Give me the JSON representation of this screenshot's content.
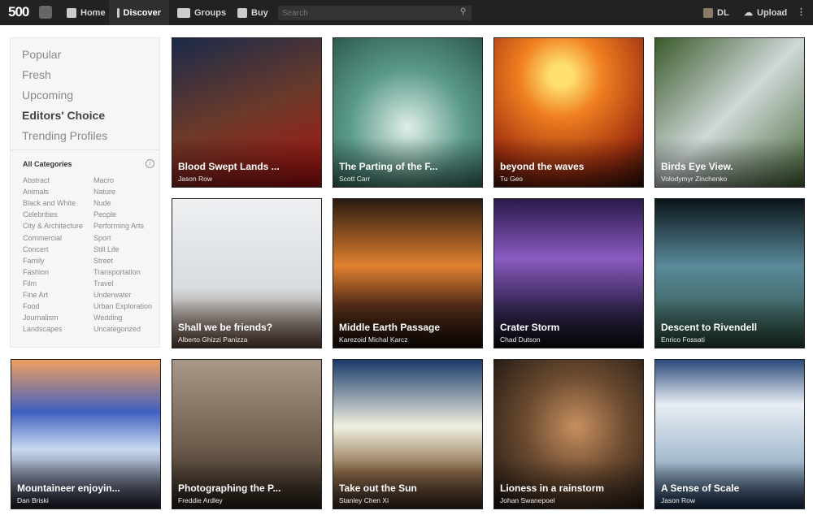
{
  "header": {
    "logo": "500",
    "nav": [
      "Home",
      "Discover",
      "Groups",
      "Buy"
    ],
    "search_placeholder": "Search",
    "user": "DL",
    "upload": "Upload"
  },
  "sidebar": {
    "menu": [
      "Popular",
      "Fresh",
      "Upcoming",
      "Editors' Choice",
      "Trending Profiles"
    ],
    "active": "Editors' Choice",
    "categories_title": "All Categories",
    "categories_left": [
      "Abstract",
      "Animals",
      "Black and White",
      "Celebrities",
      "City & Architecture",
      "Commercial",
      "Concert",
      "Family",
      "Fashion",
      "Film",
      "Fine Art",
      "Food",
      "Journalism",
      "Landscapes"
    ],
    "categories_right": [
      "Macro",
      "Nature",
      "Nude",
      "People",
      "Performing Arts",
      "Sport",
      "Still Life",
      "Street",
      "Transportation",
      "Travel",
      "Underwater",
      "Urban Exploration",
      "Wedding",
      "Uncategorized"
    ]
  },
  "photos": [
    {
      "title": "Blood Swept Lands ...",
      "author": "Jason Row",
      "bg": "linear-gradient(160deg,#1a2a4a,#6b3a2a 50%,#b01010)"
    },
    {
      "title": "The Parting of the F...",
      "author": "Scott Carr",
      "bg": "radial-gradient(circle at 50% 60%,#dfeee8,#5a9a8a 50%,#2e5a50)"
    },
    {
      "title": "beyond the waves",
      "author": "Tu Geo",
      "bg": "radial-gradient(circle at 45% 25%,#ffe070 8%,#f08020 30%,#a03010 70%,#301008)"
    },
    {
      "title": "Birds Eye View.",
      "author": "Volodymyr Zinchenko",
      "bg": "linear-gradient(135deg,#3a5a2a,#cfd8d8 50%,#4a6a3a)"
    },
    {
      "title": "Shall we be friends?",
      "author": "Alberto Ghizzi Panizza",
      "bg": "linear-gradient(180deg,#eef0f2,#d8dcdf 60%,#6a5040)"
    },
    {
      "title": "Middle Earth Passage",
      "author": "Karezoid Michal Karcz",
      "bg": "linear-gradient(180deg,#2a1a10,#e08030 45%,#5a3018 70%,#1a1008)"
    },
    {
      "title": "Crater Storm",
      "author": "Chad Dutson",
      "bg": "linear-gradient(180deg,#2a1a4a,#8a5ac0 40%,#3a2a5a 70%,#101018)"
    },
    {
      "title": "Descent to Rivendell",
      "author": "Enrico Fossati",
      "bg": "linear-gradient(180deg,#0a1418,#5a8a9a 45%,#2a4a3a)"
    },
    {
      "title": "Mountaineer enjoyin...",
      "author": "Dan Briski",
      "bg": "linear-gradient(180deg,#f0a060,#4060c0 35%,#c8d8f0 60%,#202030)"
    },
    {
      "title": "Photographing the P...",
      "author": "Freddie Ardley",
      "bg": "linear-gradient(180deg,#a89888,#6a5a4a 60%,#2a2018)"
    },
    {
      "title": "Take out the Sun",
      "author": "Stanley Chen Xi",
      "bg": "linear-gradient(180deg,#1a3a6a,#f0f0e0 45%,#8a6a4a 75%,#3a2a20)"
    },
    {
      "title": "Lioness in a rainstorm",
      "author": "Johan Swanepoel",
      "bg": "radial-gradient(circle at 55% 45%,#c89060,#6a4a30 45%,#1a1410)"
    },
    {
      "title": "A Sense of Scale",
      "author": "Jason Row",
      "bg": "linear-gradient(180deg,#2a4a7a,#e8eef4 30%,#a0b8cc 70%,#1a3050)"
    }
  ]
}
